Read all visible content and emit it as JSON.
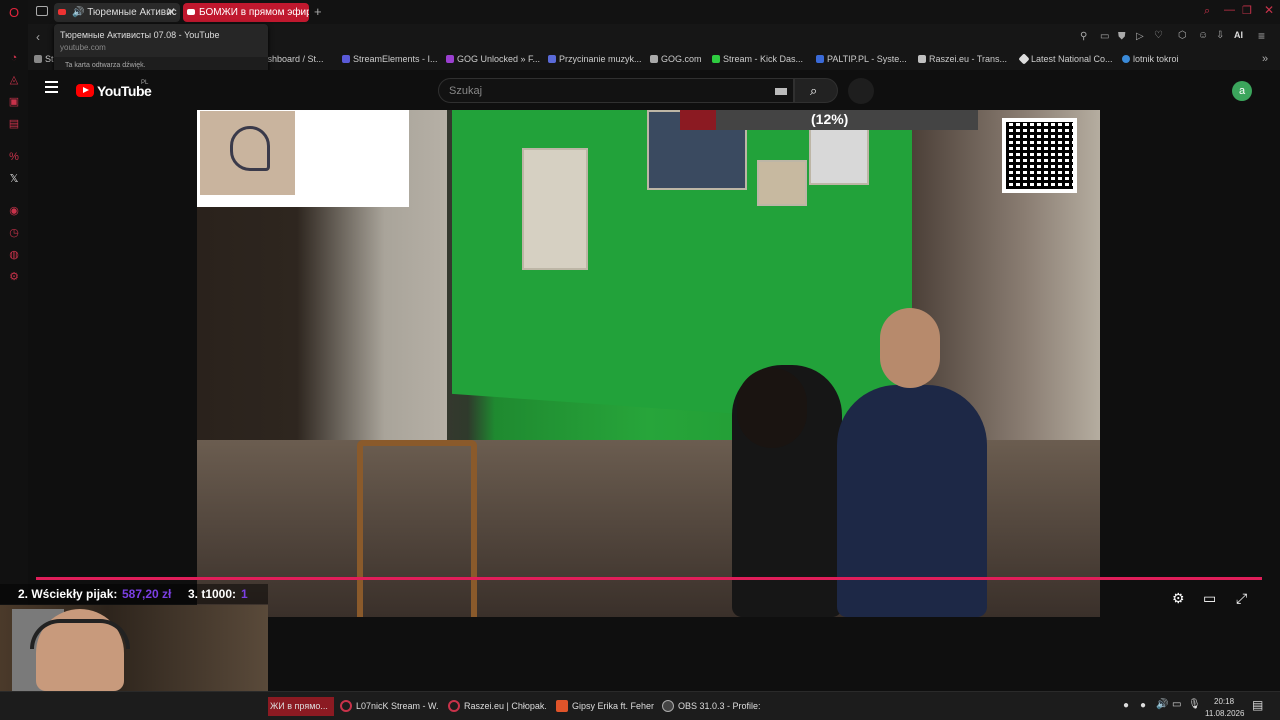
{
  "browser": {
    "tabs": [
      {
        "label": "Тюремные Активис",
        "active": true
      },
      {
        "label": "БОМЖИ в прямом эфире",
        "active": false
      }
    ],
    "new_tab": "+",
    "tooltip": {
      "title": "Тюремные Активисты 07.08 - YouTube",
      "url": "youtube.com",
      "audio": "Ta karta odtwarza dźwięk."
    },
    "ai_label": "AI",
    "bookmarks": [
      {
        "label": "St",
        "color": "#888"
      },
      {
        "label": "Dashboard / St...",
        "color": "#666"
      },
      {
        "label": "StreamElements - I...",
        "color": "#5a5ad8"
      },
      {
        "label": "GOG Unlocked » F...",
        "color": "#9b3fd0"
      },
      {
        "label": "Przycinanie muzyk...",
        "color": "#5a6ad8"
      },
      {
        "label": "GOG.com",
        "color": "#aaa"
      },
      {
        "label": "Stream - Kick Das...",
        "color": "#2ecc40"
      },
      {
        "label": "PALTIP.PL - Syste...",
        "color": "#3a6ad8"
      },
      {
        "label": "Raszei.eu - Trans...",
        "color": "#c0c0c0"
      },
      {
        "label": "Latest National Co...",
        "color": "#ddd"
      },
      {
        "label": "lotnik tokroi",
        "color": "#3a8ad8"
      }
    ]
  },
  "youtube": {
    "logo": "YouTube",
    "region": "PL",
    "search_placeholder": "Szukaj",
    "avatar_letter": "a"
  },
  "overlay": {
    "donation_percent_text": "(12%)",
    "donation_fraction": 0.12,
    "leaderboard": [
      {
        "rank_name": "2. Wściekły pijak:",
        "amount": "587,20 zł"
      },
      {
        "rank_name": "3. t1000:",
        "amount": "1"
      }
    ]
  },
  "taskbar": {
    "items": [
      {
        "label": "ЖИ в прямо...",
        "color": "#c8324a"
      },
      {
        "label": "L07nicK Stream - W...",
        "color": "#c8324a"
      },
      {
        "label": "Raszei.eu | Chłopak...",
        "color": "#c8324a"
      },
      {
        "label": "Gipsy Erika ft. Feher...",
        "color": "#e0542a"
      },
      {
        "label": "OBS 31.0.3 - Profile:...",
        "color": "#444"
      }
    ],
    "time": "20:18",
    "date": "11.08.2026"
  },
  "colors": {
    "accent": "#e01e5a",
    "opera_red": "#c8324a",
    "youtube_red": "#ff0000"
  }
}
